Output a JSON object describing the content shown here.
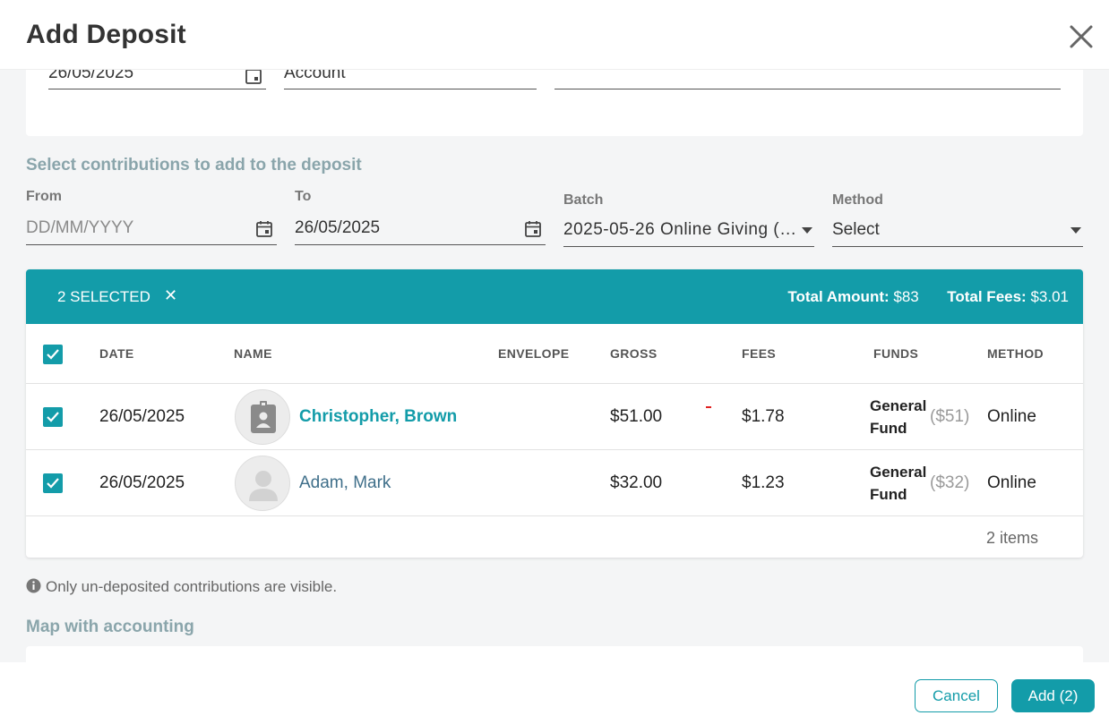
{
  "dialog": {
    "title": "Add Deposit"
  },
  "top_form": {
    "date_value": "26/05/2025",
    "account_placeholder": "Account"
  },
  "contributions": {
    "section_title": "Select contributions to add to the deposit",
    "from": {
      "label": "From",
      "placeholder": "DD/MM/YYYY"
    },
    "to": {
      "label": "To",
      "value": "26/05/2025"
    },
    "batch": {
      "label": "Batch",
      "value": "2025-05-26 Online Giving (…"
    },
    "method": {
      "label": "Method",
      "value": "Select"
    }
  },
  "selection": {
    "count_label": "2 SELECTED",
    "clear_label": "✕",
    "total_amount_label": "Total Amount:",
    "total_amount_value": "$83",
    "total_fees_label": "Total Fees:",
    "total_fees_value": "$3.01"
  },
  "table": {
    "headers": {
      "date": "DATE",
      "name": "NAME",
      "envelope": "ENVELOPE",
      "gross": "GROSS",
      "fees": "FEES",
      "funds": "FUNDS",
      "method": "METHOD"
    },
    "rows": [
      {
        "date": "26/05/2025",
        "name": "Christopher, Brown",
        "gross": "$51.00",
        "fees": "$1.78",
        "fund_line1": "General",
        "fund_line2": "Fund",
        "fund_amount": "($51)",
        "method": "Online",
        "checked": true
      },
      {
        "date": "26/05/2025",
        "name": "Adam, Mark",
        "gross": "$32.00",
        "fees": "$1.23",
        "fund_line1": "General",
        "fund_line2": "Fund",
        "fund_amount": "($32)",
        "method": "Online",
        "checked": true
      }
    ],
    "items_count": "2 items"
  },
  "note": "Only un-deposited contributions are visible.",
  "accounting": {
    "section_title": "Map with accounting"
  },
  "footer": {
    "cancel_label": "Cancel",
    "add_label": "Add (2)"
  },
  "colors": {
    "accent": "#139ca9",
    "section_title": "#8aa5ab",
    "background": "#f4f5f6"
  }
}
